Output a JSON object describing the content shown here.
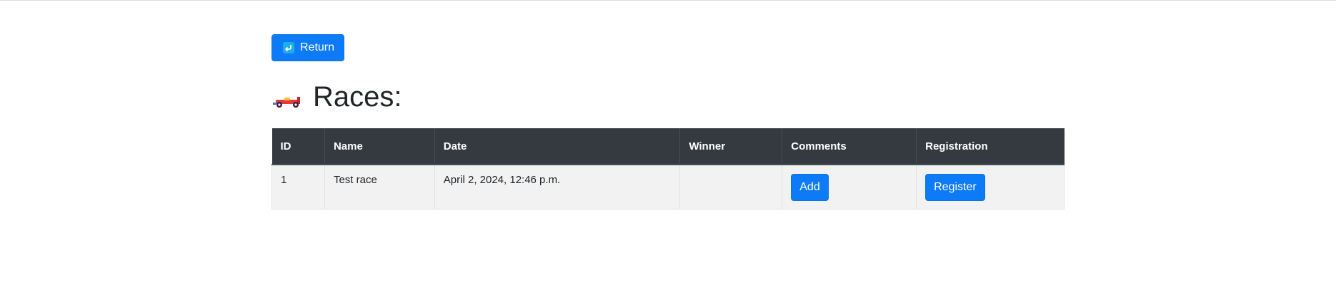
{
  "return_button": {
    "label": "Return",
    "icon": "return-arrow-icon"
  },
  "page_title": "Races:",
  "title_icon": "race-car-icon",
  "table": {
    "headers": {
      "id": "ID",
      "name": "Name",
      "date": "Date",
      "winner": "Winner",
      "comments": "Comments",
      "registration": "Registration"
    },
    "rows": [
      {
        "id": "1",
        "name": "Test race",
        "date": "April 2, 2024, 12:46 p.m.",
        "winner": "",
        "comments_button": "Add",
        "registration_button": "Register"
      }
    ]
  },
  "colors": {
    "primary": "#0d7bf8",
    "table_header_bg": "#343a40",
    "row_bg": "#f2f2f2"
  }
}
